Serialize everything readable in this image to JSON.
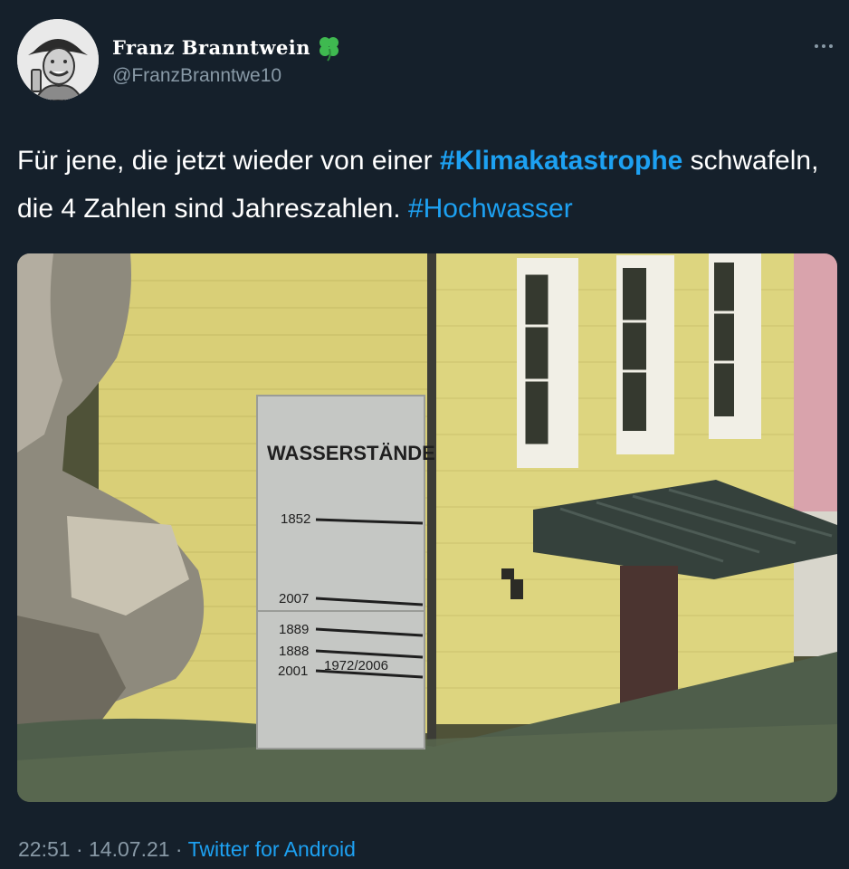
{
  "author": {
    "display_name": "Franz Branntwein",
    "handle": "@FranzBranntwe10",
    "avatar_icon": "vintage-man-portrait-icon",
    "badge_icon": "four-leaf-clover-icon"
  },
  "more_icon": "more-options-icon",
  "tweet": {
    "text_part1": "Für jene, die jetzt wieder von einer ",
    "hashtag1": "#Klimakatastrophe",
    "text_part2": " schwafeln, die 4 Zahlen sind Jahreszahlen. ",
    "hashtag2": "#Hochwasser"
  },
  "media": {
    "sign_title": "WASSERSTÄNDE",
    "marks": [
      "1852",
      "2007",
      "1889",
      "1888",
      "2001",
      "1972/2006"
    ]
  },
  "meta": {
    "time": "22:51",
    "date": "14.07.21",
    "separator": " · ",
    "source": "Twitter for Android"
  },
  "colors": {
    "background": "#15202b",
    "link": "#1da1f2",
    "secondary_text": "#8899a6"
  }
}
